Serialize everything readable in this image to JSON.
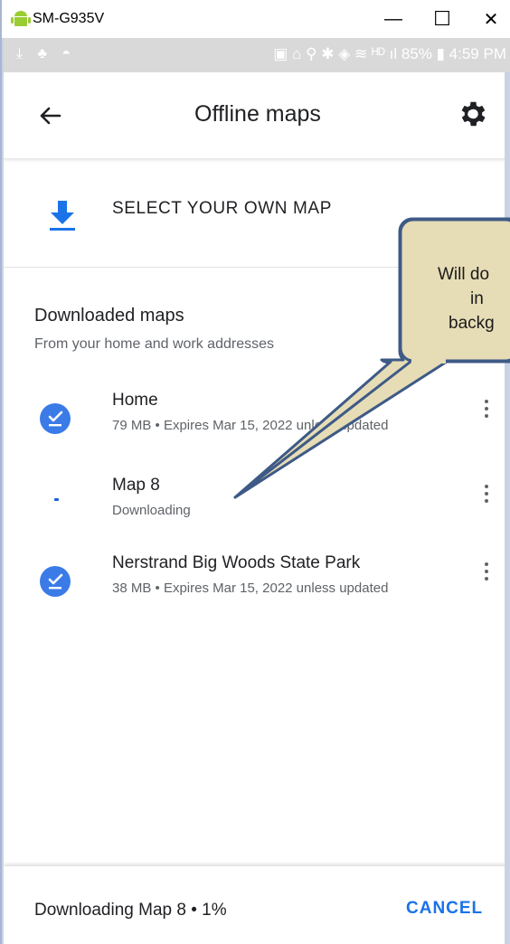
{
  "window": {
    "title": "SM-G935V",
    "minimize_label": "—",
    "maximize_label": "☐",
    "close_label": "✕"
  },
  "statusbar": {
    "left_icons": "⤓ ♣ ◓",
    "right_text": "▣ ⌂ ⚲ ✱ ◈ ≋ ᴴᴰ ıl 85% ▮ 4:59 PM"
  },
  "appbar": {
    "title": "Offline maps"
  },
  "select_map": {
    "label": "SELECT YOUR OWN MAP"
  },
  "downloaded": {
    "heading": "Downloaded maps",
    "subheading": "From your home and work addresses",
    "items": [
      {
        "name": "Home",
        "meta": "79 MB • Expires Mar 15, 2022 unless updated",
        "status": "complete"
      },
      {
        "name": "Map 8",
        "meta": "Downloading",
        "status": "downloading"
      },
      {
        "name": "Nerstrand Big Woods State Park",
        "meta": "38 MB • Expires Mar 15, 2022 unless updated",
        "status": "complete"
      }
    ]
  },
  "bottom_bar": {
    "progress_text": "Downloading Map 8 • 1%",
    "cancel_label": "CANCEL"
  },
  "callout": {
    "line1": "Will do",
    "line2": "in",
    "line3": "backg"
  },
  "colors": {
    "accent": "#1a73e8",
    "check_bg": "#3b7be8",
    "callout_fill": "#e6dcb6",
    "callout_border": "#3e5a86"
  }
}
